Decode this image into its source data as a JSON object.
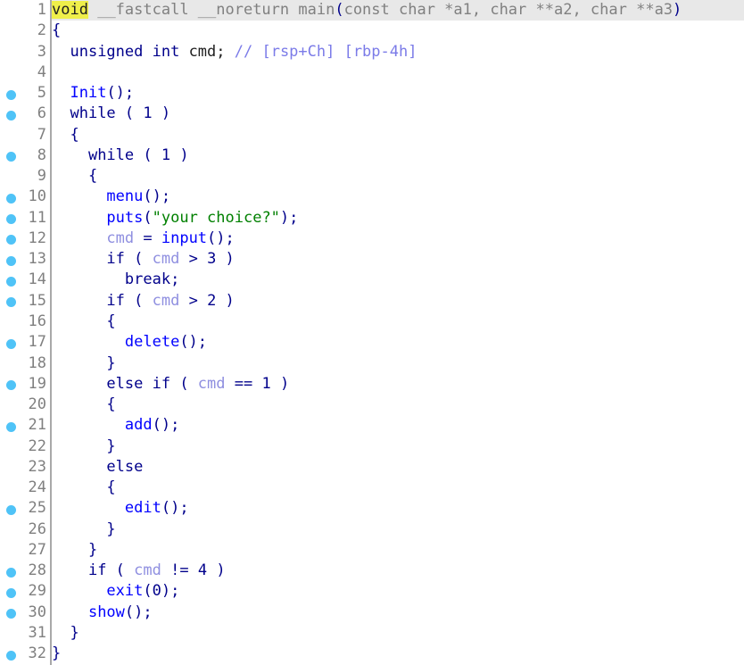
{
  "view": {
    "type": "decompiler-pseudocode",
    "function_name": "main",
    "total_lines": 32,
    "current_line": 1,
    "highlighted_token": "void"
  },
  "colors": {
    "background": "#ffffff",
    "current_line_background": "#e8e8e8",
    "highlight_token_background": "#efef4a",
    "gutter_dot": "#4fc3f7",
    "line_number": "#808080",
    "separator": "#a9a9a9",
    "keyword": "#00008b",
    "function": "#0000ff",
    "variable": "#8f8fe0",
    "string": "#008000",
    "comment": "#7b7be8",
    "dimmed": "#808080"
  },
  "lines": [
    {
      "n": "1",
      "dot": false,
      "current": true,
      "tokens": [
        {
          "t": "void",
          "c": "t-hl"
        },
        {
          "t": " ",
          "c": "t-dim"
        },
        {
          "t": "__fastcall __noreturn ",
          "c": "t-dim"
        },
        {
          "t": "main",
          "c": "t-dim"
        },
        {
          "t": "(",
          "c": "t-punc"
        },
        {
          "t": "const char *a1, char **a2, char **a3",
          "c": "t-dim"
        },
        {
          "t": ")",
          "c": "t-punc"
        }
      ]
    },
    {
      "n": "2",
      "dot": false,
      "current": false,
      "tokens": [
        {
          "t": "{",
          "c": "t-punc"
        }
      ]
    },
    {
      "n": "3",
      "dot": false,
      "current": false,
      "tokens": [
        {
          "t": "  ",
          "c": "t-plain"
        },
        {
          "t": "unsigned int",
          "c": "t-kw"
        },
        {
          "t": " ",
          "c": "t-plain"
        },
        {
          "t": "cmd;",
          "c": "t-plain"
        },
        {
          "t": " ",
          "c": "t-plain"
        },
        {
          "t": "// [rsp+Ch] [rbp-4h]",
          "c": "t-cmt"
        }
      ]
    },
    {
      "n": "4",
      "dot": false,
      "current": false,
      "tokens": []
    },
    {
      "n": "5",
      "dot": true,
      "current": false,
      "tokens": [
        {
          "t": "  ",
          "c": "t-plain"
        },
        {
          "t": "Init",
          "c": "t-fn"
        },
        {
          "t": "();",
          "c": "t-punc"
        }
      ]
    },
    {
      "n": "6",
      "dot": true,
      "current": false,
      "tokens": [
        {
          "t": "  ",
          "c": "t-plain"
        },
        {
          "t": "while",
          "c": "t-kw"
        },
        {
          "t": " ( ",
          "c": "t-punc"
        },
        {
          "t": "1",
          "c": "t-num"
        },
        {
          "t": " )",
          "c": "t-punc"
        }
      ]
    },
    {
      "n": "7",
      "dot": false,
      "current": false,
      "tokens": [
        {
          "t": "  ",
          "c": "t-plain"
        },
        {
          "t": "{",
          "c": "t-punc"
        }
      ]
    },
    {
      "n": "8",
      "dot": true,
      "current": false,
      "tokens": [
        {
          "t": "    ",
          "c": "t-plain"
        },
        {
          "t": "while",
          "c": "t-kw"
        },
        {
          "t": " ( ",
          "c": "t-punc"
        },
        {
          "t": "1",
          "c": "t-num"
        },
        {
          "t": " )",
          "c": "t-punc"
        }
      ]
    },
    {
      "n": "9",
      "dot": false,
      "current": false,
      "tokens": [
        {
          "t": "    ",
          "c": "t-plain"
        },
        {
          "t": "{",
          "c": "t-punc"
        }
      ]
    },
    {
      "n": "10",
      "dot": true,
      "current": false,
      "tokens": [
        {
          "t": "      ",
          "c": "t-plain"
        },
        {
          "t": "menu",
          "c": "t-fn"
        },
        {
          "t": "();",
          "c": "t-punc"
        }
      ]
    },
    {
      "n": "11",
      "dot": true,
      "current": false,
      "tokens": [
        {
          "t": "      ",
          "c": "t-plain"
        },
        {
          "t": "puts",
          "c": "t-lib"
        },
        {
          "t": "(",
          "c": "t-punc"
        },
        {
          "t": "\"your choice?\"",
          "c": "t-str"
        },
        {
          "t": ");",
          "c": "t-punc"
        }
      ]
    },
    {
      "n": "12",
      "dot": true,
      "current": false,
      "tokens": [
        {
          "t": "      ",
          "c": "t-plain"
        },
        {
          "t": "cmd",
          "c": "t-var"
        },
        {
          "t": " = ",
          "c": "t-punc"
        },
        {
          "t": "input",
          "c": "t-fn"
        },
        {
          "t": "();",
          "c": "t-punc"
        }
      ]
    },
    {
      "n": "13",
      "dot": true,
      "current": false,
      "tokens": [
        {
          "t": "      ",
          "c": "t-plain"
        },
        {
          "t": "if",
          "c": "t-kw"
        },
        {
          "t": " ( ",
          "c": "t-punc"
        },
        {
          "t": "cmd",
          "c": "t-var"
        },
        {
          "t": " > ",
          "c": "t-punc"
        },
        {
          "t": "3",
          "c": "t-num"
        },
        {
          "t": " )",
          "c": "t-punc"
        }
      ]
    },
    {
      "n": "14",
      "dot": true,
      "current": false,
      "tokens": [
        {
          "t": "        ",
          "c": "t-plain"
        },
        {
          "t": "break;",
          "c": "t-kw"
        }
      ]
    },
    {
      "n": "15",
      "dot": true,
      "current": false,
      "tokens": [
        {
          "t": "      ",
          "c": "t-plain"
        },
        {
          "t": "if",
          "c": "t-kw"
        },
        {
          "t": " ( ",
          "c": "t-punc"
        },
        {
          "t": "cmd",
          "c": "t-var"
        },
        {
          "t": " > ",
          "c": "t-punc"
        },
        {
          "t": "2",
          "c": "t-num"
        },
        {
          "t": " )",
          "c": "t-punc"
        }
      ]
    },
    {
      "n": "16",
      "dot": false,
      "current": false,
      "tokens": [
        {
          "t": "      ",
          "c": "t-plain"
        },
        {
          "t": "{",
          "c": "t-punc"
        }
      ]
    },
    {
      "n": "17",
      "dot": true,
      "current": false,
      "tokens": [
        {
          "t": "        ",
          "c": "t-plain"
        },
        {
          "t": "delete",
          "c": "t-fn"
        },
        {
          "t": "();",
          "c": "t-punc"
        }
      ]
    },
    {
      "n": "18",
      "dot": false,
      "current": false,
      "tokens": [
        {
          "t": "      ",
          "c": "t-plain"
        },
        {
          "t": "}",
          "c": "t-punc"
        }
      ]
    },
    {
      "n": "19",
      "dot": true,
      "current": false,
      "tokens": [
        {
          "t": "      ",
          "c": "t-plain"
        },
        {
          "t": "else if",
          "c": "t-kw"
        },
        {
          "t": " ( ",
          "c": "t-punc"
        },
        {
          "t": "cmd",
          "c": "t-var"
        },
        {
          "t": " == ",
          "c": "t-punc"
        },
        {
          "t": "1",
          "c": "t-num"
        },
        {
          "t": " )",
          "c": "t-punc"
        }
      ]
    },
    {
      "n": "20",
      "dot": false,
      "current": false,
      "tokens": [
        {
          "t": "      ",
          "c": "t-plain"
        },
        {
          "t": "{",
          "c": "t-punc"
        }
      ]
    },
    {
      "n": "21",
      "dot": true,
      "current": false,
      "tokens": [
        {
          "t": "        ",
          "c": "t-plain"
        },
        {
          "t": "add",
          "c": "t-fn"
        },
        {
          "t": "();",
          "c": "t-punc"
        }
      ]
    },
    {
      "n": "22",
      "dot": false,
      "current": false,
      "tokens": [
        {
          "t": "      ",
          "c": "t-plain"
        },
        {
          "t": "}",
          "c": "t-punc"
        }
      ]
    },
    {
      "n": "23",
      "dot": false,
      "current": false,
      "tokens": [
        {
          "t": "      ",
          "c": "t-plain"
        },
        {
          "t": "else",
          "c": "t-kw"
        }
      ]
    },
    {
      "n": "24",
      "dot": false,
      "current": false,
      "tokens": [
        {
          "t": "      ",
          "c": "t-plain"
        },
        {
          "t": "{",
          "c": "t-punc"
        }
      ]
    },
    {
      "n": "25",
      "dot": true,
      "current": false,
      "tokens": [
        {
          "t": "        ",
          "c": "t-plain"
        },
        {
          "t": "edit",
          "c": "t-fn"
        },
        {
          "t": "();",
          "c": "t-punc"
        }
      ]
    },
    {
      "n": "26",
      "dot": false,
      "current": false,
      "tokens": [
        {
          "t": "      ",
          "c": "t-plain"
        },
        {
          "t": "}",
          "c": "t-punc"
        }
      ]
    },
    {
      "n": "27",
      "dot": false,
      "current": false,
      "tokens": [
        {
          "t": "    ",
          "c": "t-plain"
        },
        {
          "t": "}",
          "c": "t-punc"
        }
      ]
    },
    {
      "n": "28",
      "dot": true,
      "current": false,
      "tokens": [
        {
          "t": "    ",
          "c": "t-plain"
        },
        {
          "t": "if",
          "c": "t-kw"
        },
        {
          "t": " ( ",
          "c": "t-punc"
        },
        {
          "t": "cmd",
          "c": "t-var"
        },
        {
          "t": " != ",
          "c": "t-punc"
        },
        {
          "t": "4",
          "c": "t-num"
        },
        {
          "t": " )",
          "c": "t-punc"
        }
      ]
    },
    {
      "n": "29",
      "dot": true,
      "current": false,
      "tokens": [
        {
          "t": "      ",
          "c": "t-plain"
        },
        {
          "t": "exit",
          "c": "t-lib"
        },
        {
          "t": "(",
          "c": "t-punc"
        },
        {
          "t": "0",
          "c": "t-num"
        },
        {
          "t": ");",
          "c": "t-punc"
        }
      ]
    },
    {
      "n": "30",
      "dot": true,
      "current": false,
      "tokens": [
        {
          "t": "    ",
          "c": "t-plain"
        },
        {
          "t": "show",
          "c": "t-fn"
        },
        {
          "t": "();",
          "c": "t-punc"
        }
      ]
    },
    {
      "n": "31",
      "dot": false,
      "current": false,
      "tokens": [
        {
          "t": "  ",
          "c": "t-plain"
        },
        {
          "t": "}",
          "c": "t-punc"
        }
      ]
    },
    {
      "n": "32",
      "dot": true,
      "current": false,
      "tokens": [
        {
          "t": "}",
          "c": "t-punc"
        }
      ]
    }
  ]
}
